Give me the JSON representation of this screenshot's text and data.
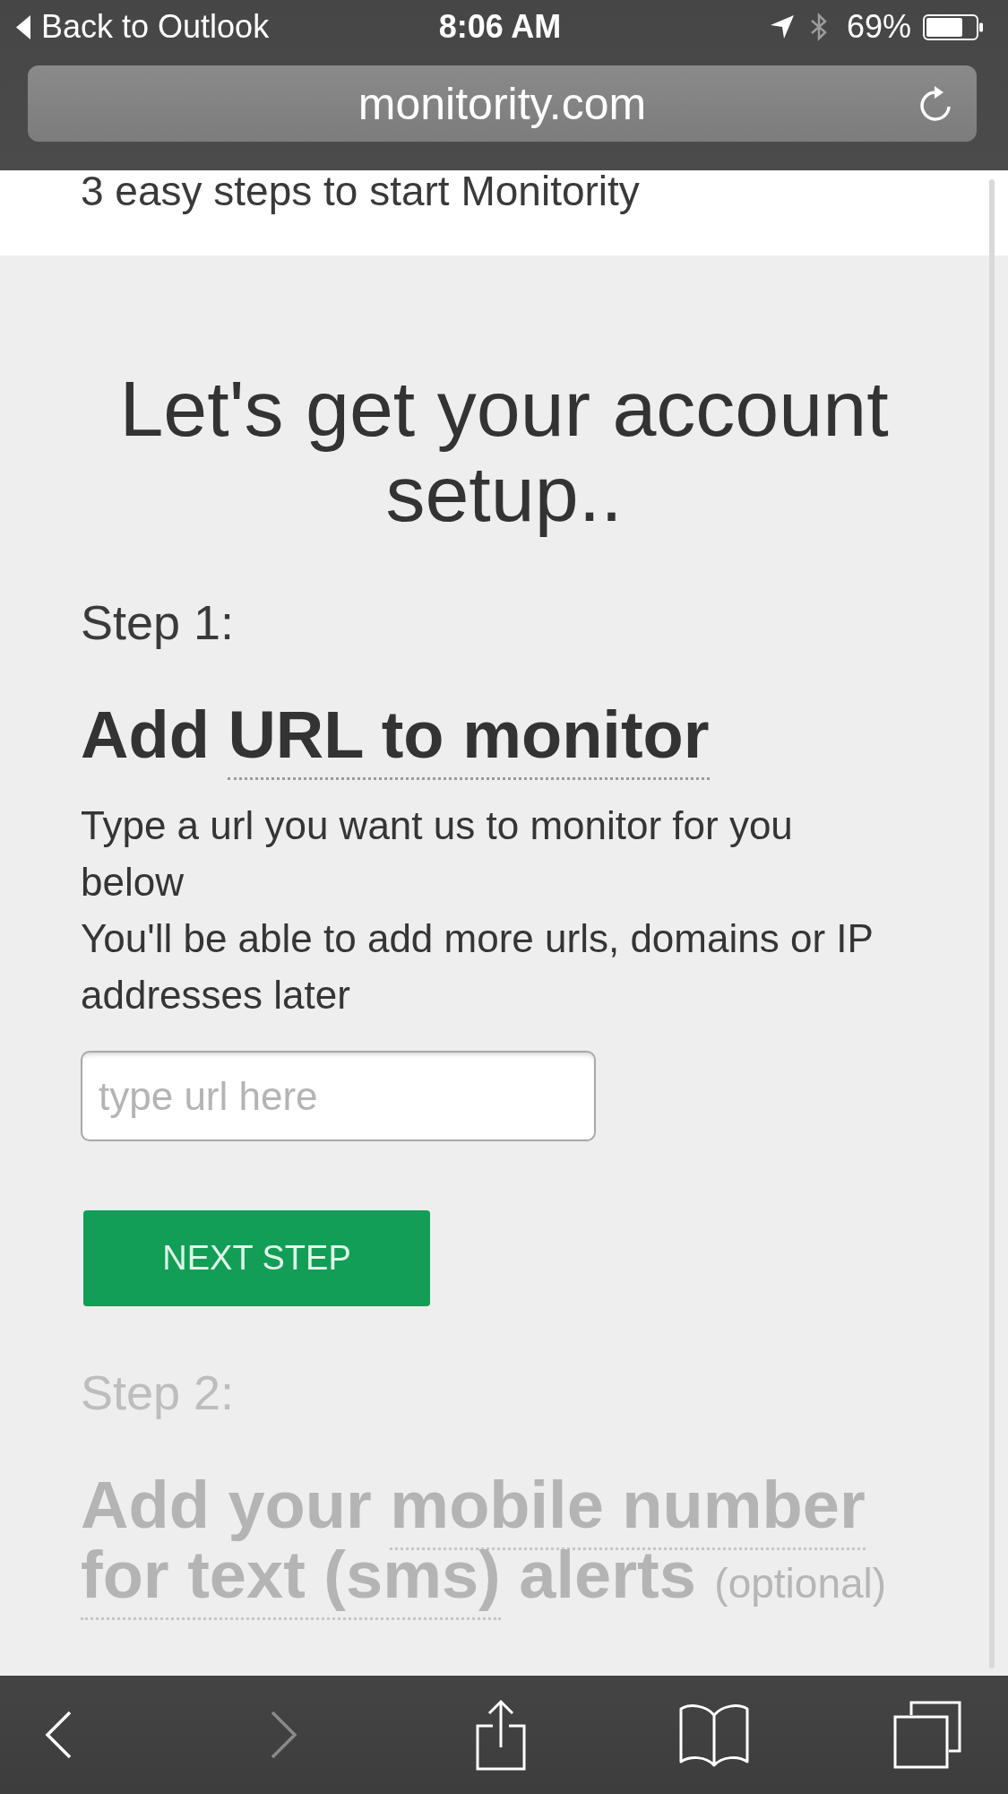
{
  "status_bar": {
    "back_link": "Back to Outlook",
    "time": "8:06 AM",
    "battery": "69%"
  },
  "address_bar": {
    "url": "monitority.com"
  },
  "page": {
    "banner": "3 easy steps to start Monitority",
    "heading": "Let's get your account setup..",
    "steps": [
      {
        "label": "Step 1:",
        "active": true,
        "title": {
          "before": "Add",
          "dotted": "URL to monitor"
        },
        "description": [
          "Type a url you want us to monitor for you below",
          "You'll be able to add more urls, domains or IP addresses later"
        ],
        "input": {
          "placeholder": "type url here"
        },
        "button": "NEXT STEP"
      },
      {
        "label": "Step 2:",
        "active": false,
        "title": {
          "before": "Add your",
          "dotted": "mobile number for text (sms)",
          "after": "alerts",
          "note": "(optional)"
        }
      }
    ]
  },
  "toolbar": [
    {
      "kind": "back",
      "disabled": false
    },
    {
      "kind": "forward",
      "disabled": true
    },
    {
      "kind": "share",
      "disabled": false
    },
    {
      "kind": "bookmarks",
      "disabled": false
    },
    {
      "kind": "tabs",
      "disabled": false
    }
  ]
}
